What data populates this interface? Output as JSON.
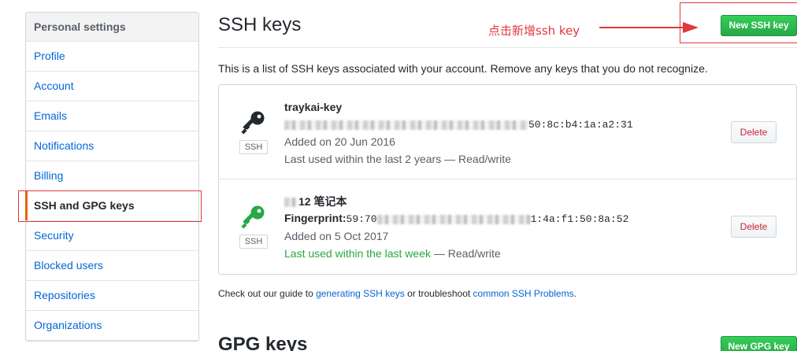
{
  "sidebar": {
    "header": "Personal settings",
    "items": [
      {
        "label": "Profile"
      },
      {
        "label": "Account"
      },
      {
        "label": "Emails"
      },
      {
        "label": "Notifications"
      },
      {
        "label": "Billing"
      },
      {
        "label": "SSH and GPG keys",
        "selected": true
      },
      {
        "label": "Security"
      },
      {
        "label": "Blocked users"
      },
      {
        "label": "Repositories"
      },
      {
        "label": "Organizations"
      }
    ]
  },
  "main": {
    "title": "SSH keys",
    "annotation": "点击新增ssh key",
    "new_ssh_button": "New SSH key",
    "intro": "This is a list of SSH keys associated with your account. Remove any keys that you do not recognize.",
    "keys": [
      {
        "title": "traykai-key",
        "fingerprint_tail": "50:8c:b4:1a:a2:31",
        "badge": "SSH",
        "added": "Added on 20 Jun 2016",
        "last_used": "Last used within the last 2 years",
        "access": "Read/write",
        "recent": false,
        "icon_color": "#24292e",
        "delete_label": "Delete"
      },
      {
        "title": "12 笔记本",
        "fingerprint_label": "Fingerprint:",
        "fingerprint_head": "59:70",
        "fingerprint_tail": "1:4a:f1:50:8a:52",
        "badge": "SSH",
        "added": "Added on 5 Oct 2017",
        "last_used": "Last used within the last week",
        "access": "Read/write",
        "recent": true,
        "icon_color": "#28a745",
        "delete_label": "Delete"
      }
    ],
    "footer": {
      "prefix": "Check out our guide to ",
      "link1": "generating SSH keys",
      "middle": " or troubleshoot ",
      "link2": "common SSH Problems",
      "suffix": "."
    },
    "gpg_title": "GPG keys",
    "new_gpg_button": "New GPG key"
  },
  "colors": {
    "link": "#0366d6",
    "accent_green": "#28a745",
    "annotation_red": "#e0393e",
    "danger": "#cb2431"
  }
}
